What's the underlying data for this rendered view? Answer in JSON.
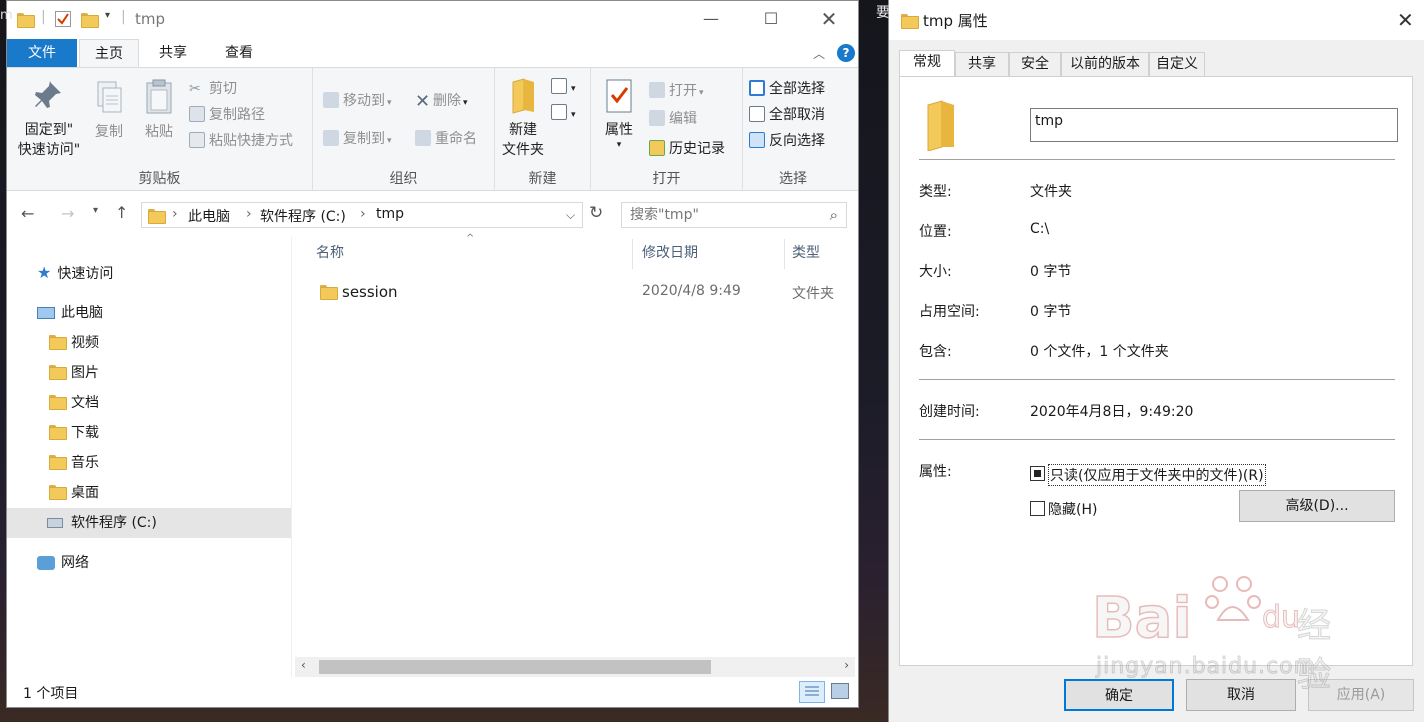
{
  "explorer": {
    "title": "tmp",
    "tabs": {
      "file": "文件",
      "home": "主页",
      "share": "共享",
      "view": "查看"
    },
    "help_icon": "?",
    "ribbon": {
      "clipboard": {
        "label": "剪贴板",
        "pin_line1": "固定到\"",
        "pin_line2": "快速访问\"",
        "copy": "复制",
        "paste": "粘贴",
        "cut": "剪切",
        "copy_path": "复制路径",
        "paste_shortcut": "粘贴快捷方式"
      },
      "organize": {
        "label": "组织",
        "move_to": "移动到",
        "copy_to": "复制到",
        "delete": "删除",
        "rename": "重命名"
      },
      "new": {
        "label": "新建",
        "new_folder_line1": "新建",
        "new_folder_line2": "文件夹"
      },
      "open": {
        "label": "打开",
        "properties": "属性",
        "open": "打开",
        "edit": "编辑",
        "history": "历史记录"
      },
      "select": {
        "label": "选择",
        "select_all": "全部选择",
        "select_none": "全部取消",
        "invert": "反向选择"
      }
    },
    "address": {
      "crumbs": [
        "此电脑",
        "软件程序 (C:)",
        "tmp"
      ],
      "search_placeholder": "搜索\"tmp\""
    },
    "nav": {
      "quick_access": "快速访问",
      "this_pc": "此电脑",
      "items": [
        "视频",
        "图片",
        "文档",
        "下载",
        "音乐",
        "桌面",
        "软件程序 (C:)"
      ],
      "network": "网络"
    },
    "columns": {
      "name": "名称",
      "date": "修改日期",
      "type": "类型"
    },
    "files": [
      {
        "name": "session",
        "date": "2020/4/8 9:49",
        "type": "文件夹"
      }
    ],
    "status": "1 个项目"
  },
  "props": {
    "title": "tmp 属性",
    "tabs": [
      "常规",
      "共享",
      "安全",
      "以前的版本",
      "自定义"
    ],
    "name_value": "tmp",
    "rows": {
      "type_label": "类型:",
      "type_value": "文件夹",
      "location_label": "位置:",
      "location_value": "C:\\",
      "size_label": "大小:",
      "size_value": "0 字节",
      "disk_label": "占用空间:",
      "disk_value": "0 字节",
      "contains_label": "包含:",
      "contains_value": "0 个文件，1 个文件夹",
      "created_label": "创建时间:",
      "created_value": "2020年4月8日，9:49:20",
      "attr_label": "属性:"
    },
    "attributes": {
      "readonly_label": "只读(仅应用于文件夹中的文件)(R)",
      "readonly_state": "indeterminate",
      "hidden_label": "隐藏(H)",
      "hidden_checked": false,
      "advanced": "高级(D)..."
    },
    "buttons": {
      "ok": "确定",
      "cancel": "取消",
      "apply": "应用(A)"
    }
  },
  "watermark": {
    "brand": "Bai",
    "suffix": "du",
    "cn": "经验",
    "url": "jingyan.baidu.com"
  },
  "colors": {
    "accent": "#1979ca",
    "folder": "#f3c95a",
    "selection": "#e5e5e5"
  }
}
